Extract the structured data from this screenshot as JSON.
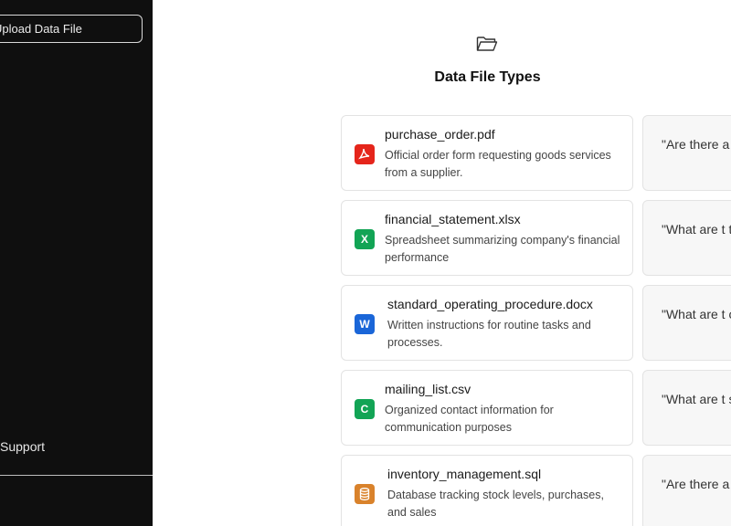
{
  "sidebar": {
    "upload_label": "Upload Data File",
    "support_label": "Support"
  },
  "main": {
    "title": "Data File Types",
    "files": [
      {
        "name": "purchase_order.pdf",
        "desc": "Official order form requesting goods services from a supplier.",
        "badge": "",
        "color": "#e5251b",
        "icon": "pdf-icon",
        "question": "\"Are there a associated"
      },
      {
        "name": "financial_statement.xlsx",
        "desc": "Spreadsheet summarizing company's financial performance",
        "badge": "X",
        "color": "#12a455",
        "icon": "excel-icon",
        "question": "\"What are t they be opt"
      },
      {
        "name": "standard_operating_procedure.docx",
        "desc": "Written instructions for routine tasks and processes.",
        "badge": "W",
        "color": "#1a66d8",
        "icon": "word-icon",
        "question": "\"What are t outlined in t"
      },
      {
        "name": "mailing_list.csv",
        "desc": "Organized contact information for communication purposes",
        "badge": "C",
        "color": "#12a455",
        "icon": "csv-icon",
        "question": "\"What are t segments in"
      },
      {
        "name": "inventory_management.sql",
        "desc": "Database tracking stock levels, purchases, and sales",
        "badge": "",
        "color": "#d9822b",
        "icon": "database-icon",
        "question": "\"Are there a stockouts?\""
      }
    ]
  }
}
